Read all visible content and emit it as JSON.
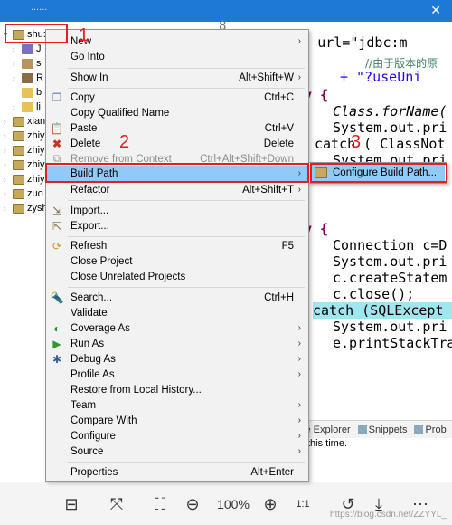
{
  "topbar": {
    "partial_label": "......"
  },
  "tree": {
    "items": [
      {
        "label": "shu:",
        "selected": true
      },
      {
        "label": "J"
      },
      {
        "label": "s"
      },
      {
        "label": "R"
      },
      {
        "label": "b"
      },
      {
        "label": "li"
      },
      {
        "label": "xian"
      },
      {
        "label": "zhiy"
      },
      {
        "label": "zhiy"
      },
      {
        "label": "zhiy"
      },
      {
        "label": "zhiy"
      },
      {
        "label": "zuo"
      },
      {
        "label": "zysh"
      }
    ]
  },
  "editor": {
    "line_number": "8",
    "lines": [
      "tring url=\"jdbc:m",
      "//由于版本的原",
      "+ \"?useUni",
      "y {",
      "Class.forName(",
      "System.out.pri",
      "catch ( ClassNot",
      "System.out.pri",
      "y {",
      "Connection c=D",
      "System.out.pri",
      "c.createStatem",
      "c.close();",
      "catch (SQLExcept",
      "System.out.pri",
      "e.printStackTra"
    ]
  },
  "console": {
    "tabs": [
      "ce Explorer",
      "Snippets",
      "Prob"
    ],
    "message": "this time."
  },
  "context_menu": {
    "items": [
      {
        "label": "New",
        "submenu": true
      },
      {
        "label": "Go Into"
      },
      {
        "label": "Show In",
        "shortcut": "Alt+Shift+W",
        "submenu": true
      },
      {
        "label": "Copy",
        "shortcut": "Ctrl+C"
      },
      {
        "label": "Copy Qualified Name"
      },
      {
        "label": "Paste",
        "shortcut": "Ctrl+V"
      },
      {
        "label": "Delete",
        "shortcut": "Delete"
      },
      {
        "label": "Remove from Context",
        "shortcut": "Ctrl+Alt+Shift+Down",
        "disabled": true
      },
      {
        "label": "Build Path",
        "submenu": true,
        "active": true
      },
      {
        "label": "Refactor",
        "shortcut": "Alt+Shift+T",
        "submenu": true
      },
      {
        "label": "Import..."
      },
      {
        "label": "Export..."
      },
      {
        "label": "Refresh",
        "shortcut": "F5"
      },
      {
        "label": "Close Project"
      },
      {
        "label": "Close Unrelated Projects"
      },
      {
        "label": "Search...",
        "shortcut": "Ctrl+H"
      },
      {
        "label": "Validate"
      },
      {
        "label": "Coverage As",
        "submenu": true
      },
      {
        "label": "Run As",
        "submenu": true
      },
      {
        "label": "Debug As",
        "submenu": true
      },
      {
        "label": "Profile As",
        "submenu": true
      },
      {
        "label": "Restore from Local History..."
      },
      {
        "label": "Team",
        "submenu": true
      },
      {
        "label": "Compare With",
        "submenu": true
      },
      {
        "label": "Configure",
        "submenu": true
      },
      {
        "label": "Source",
        "submenu": true
      },
      {
        "label": "Properties",
        "shortcut": "Alt+Enter"
      }
    ]
  },
  "submenu": {
    "label": "Configure Build Path..."
  },
  "annotations": {
    "num1": "1",
    "num2": "2",
    "num3": "3",
    "color": "#e02020"
  },
  "viewer": {
    "zoom_label": "100%",
    "watermark": "https://blog.csdn.net/ZZYYL_"
  }
}
